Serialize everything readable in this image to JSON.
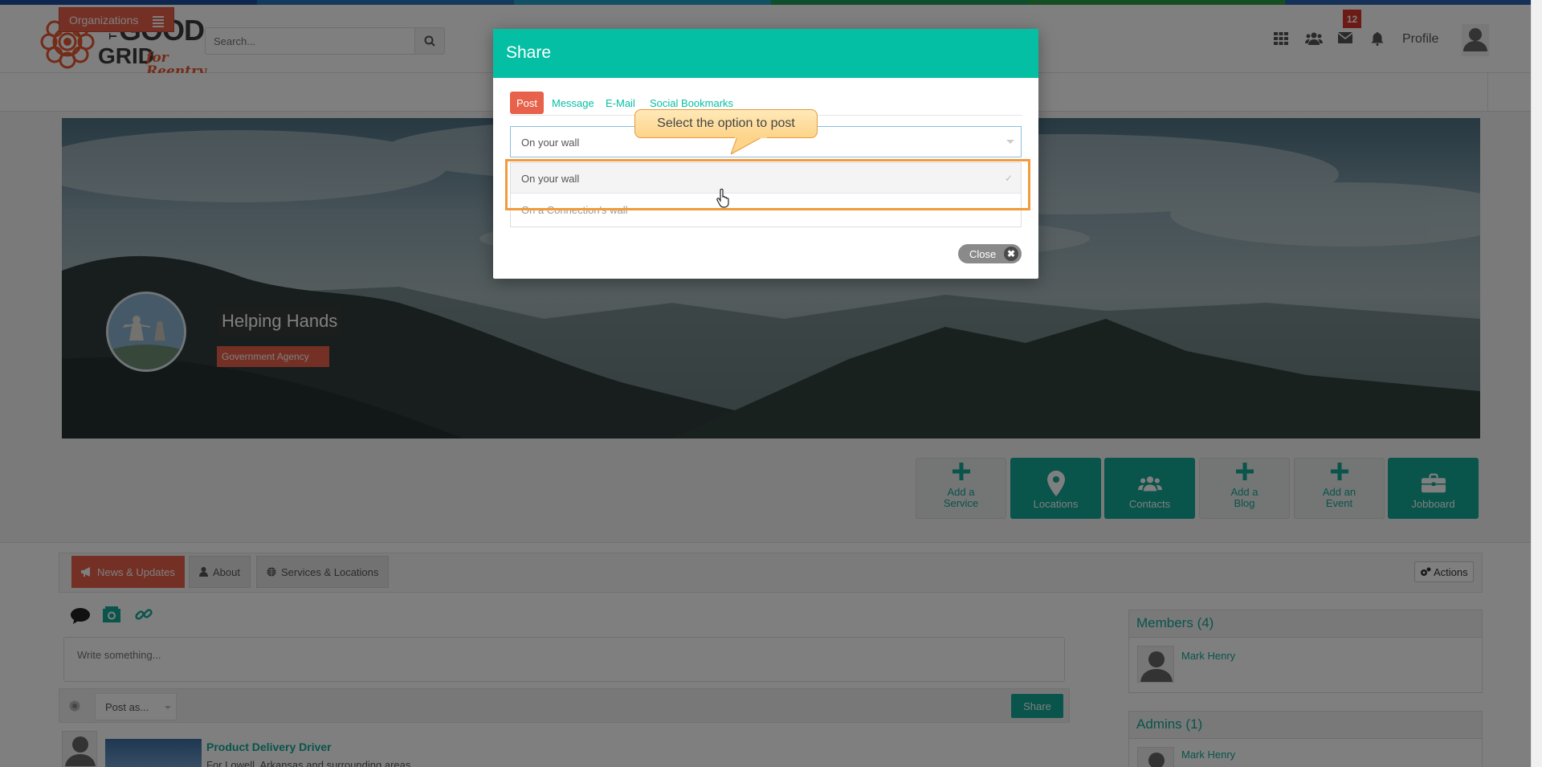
{
  "colors": {
    "teal": "#12a896",
    "modal_header": "#05bfa4",
    "coral": "#e8614a",
    "highlight_orange": "#f39a3c"
  },
  "header": {
    "logo": {
      "the": "THE",
      "good": "GOOD",
      "grid": "GRID",
      "tagline": "for Reentry"
    },
    "search_placeholder": "Search...",
    "icons": [
      "grid-icon",
      "people-icon",
      "envelope-icon",
      "bell-icon"
    ],
    "notification_count": "12",
    "profile_label": "Profile"
  },
  "orgbar": {
    "organizations_label": "Organizations"
  },
  "hero": {
    "name": "Helping Hands",
    "type": "Government Agency"
  },
  "tiles": [
    {
      "line1": "Add a",
      "line2": "Service",
      "icon": "plus-icon"
    },
    {
      "line1": "Locations",
      "line2": "",
      "icon": "map-marker-icon"
    },
    {
      "line1": "Contacts",
      "line2": "",
      "icon": "users-icon"
    },
    {
      "line1": "Add a",
      "line2": "Blog",
      "icon": "plus-icon"
    },
    {
      "line1": "Add an",
      "line2": "Event",
      "icon": "plus-icon"
    },
    {
      "line1": "Jobboard",
      "line2": "",
      "icon": "briefcase-icon"
    }
  ],
  "tabs": {
    "news": "News & Updates",
    "about": "About",
    "services": "Services & Locations",
    "actions": "Actions"
  },
  "composer": {
    "placeholder": "Write something...",
    "post_as": "Post as...",
    "share": "Share"
  },
  "feed": {
    "title": "Product Delivery Driver",
    "description": "For Lowell, Arkansas and surrounding areas"
  },
  "sidebar": {
    "members_title": "Members (4)",
    "members": [
      "Mark Henry"
    ],
    "admins_title": "Admins (1)",
    "admins": [
      "Mark Henry"
    ]
  },
  "modal": {
    "title": "Share",
    "tabs": [
      "Post",
      "Message",
      "E-Mail",
      "Social Bookmarks"
    ],
    "selected_value": "On your wall",
    "options": [
      "On your wall",
      "On a Connection's wall"
    ],
    "close_label": "Close"
  },
  "tooltip": {
    "text": "Select the option to post"
  }
}
